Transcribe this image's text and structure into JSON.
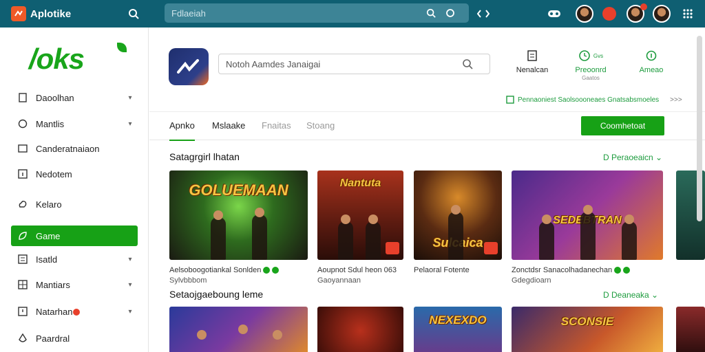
{
  "app": {
    "name": "Aplotike"
  },
  "topbar": {
    "search_placeholder": "Fdlaeiah",
    "icons": [
      "search-icon",
      "camera-icon",
      "code-icon",
      "gamepad-icon",
      "avatar",
      "notification-icon",
      "avatar",
      "avatar",
      "apps-grid-icon"
    ]
  },
  "sidebar": {
    "logo_text": "/oks",
    "items": [
      {
        "label": "Daoolhan",
        "icon": "document-icon",
        "chevron": true
      },
      {
        "label": "Mantlis",
        "icon": "chat-icon",
        "chevron": true
      },
      {
        "label": "Canderatnaiaon",
        "icon": "window-icon",
        "chevron": false
      },
      {
        "label": "Nedotem",
        "icon": "info-icon",
        "chevron": false
      },
      {
        "label": "Kelaro",
        "icon": "cloud-icon",
        "chevron": false
      },
      {
        "label": "Game",
        "icon": "leaf-icon",
        "chevron": false,
        "active": true
      },
      {
        "label": "Isatld",
        "icon": "list-icon",
        "chevron": true
      },
      {
        "label": "Mantiars",
        "icon": "grid-icon",
        "chevron": true
      },
      {
        "label": "Natarhan",
        "icon": "warning-icon",
        "chevron": true,
        "badge": true
      },
      {
        "label": "Paardral",
        "icon": "drop-icon",
        "chevron": false
      }
    ]
  },
  "main": {
    "search_placeholder": "Notoh Aamdes Janaigai",
    "quick_actions": [
      {
        "label": "Nenalcan",
        "sub": "",
        "icon": "list-doc-icon",
        "color": "#222222"
      },
      {
        "label": "Preoonrd",
        "sub": "Gaatos",
        "icon": "clock-icon",
        "color": "#1c9b3d"
      },
      {
        "label": "Ameao",
        "sub": "",
        "icon": "info-circle-icon",
        "color": "#1c9b3d"
      }
    ],
    "clock_badge": "Gvs",
    "promo_text": "Pennaoniest Saolsoooneaes Gnatsabsmoeles",
    "promo_more": ">>>",
    "tabs": [
      {
        "label": "Apnko",
        "active": true
      },
      {
        "label": "Mslaake",
        "active": false
      },
      {
        "label": "Fnaitas",
        "active": false,
        "muted": true
      },
      {
        "label": "Stoang",
        "active": false,
        "muted": true
      }
    ],
    "primary_button": "Coomhetoat",
    "sections": [
      {
        "title": "Satagrgirl lhatan",
        "link": "D Peraoeaicn ⌄",
        "cards": [
          {
            "art_title": "GOLUEMAAN",
            "caption": "Aelsoboogotiankal Sonlden",
            "sub": "Sylvbbbom",
            "badges": true
          },
          {
            "art_title": "Nantuta",
            "caption": "Aoupnot Sdul heon 063",
            "sub": "Gaoyannaan",
            "badges": false
          },
          {
            "art_title": "Sulcaica",
            "caption": "Pelaoral Fotente",
            "sub": "",
            "badges": false
          },
          {
            "art_title": "SEDEBTRAN",
            "caption": "Zonctdsr Sanacolhadanechan",
            "sub": "Gdegdioarn",
            "badges": true
          },
          {
            "art_title": "",
            "caption": "",
            "sub": "",
            "badges": false
          }
        ]
      },
      {
        "title": "Setaojgaeboung leme",
        "link": "D Deaneaka ⌄",
        "cards": [
          {
            "art_title": ""
          },
          {
            "art_title": ""
          },
          {
            "art_title": "NEXEXDO"
          },
          {
            "art_title": "SCONSIE"
          },
          {
            "art_title": ""
          }
        ]
      }
    ]
  },
  "colors": {
    "topbar": "#0f5f72",
    "accent_green": "#17a116",
    "alert_red": "#e8402b"
  }
}
